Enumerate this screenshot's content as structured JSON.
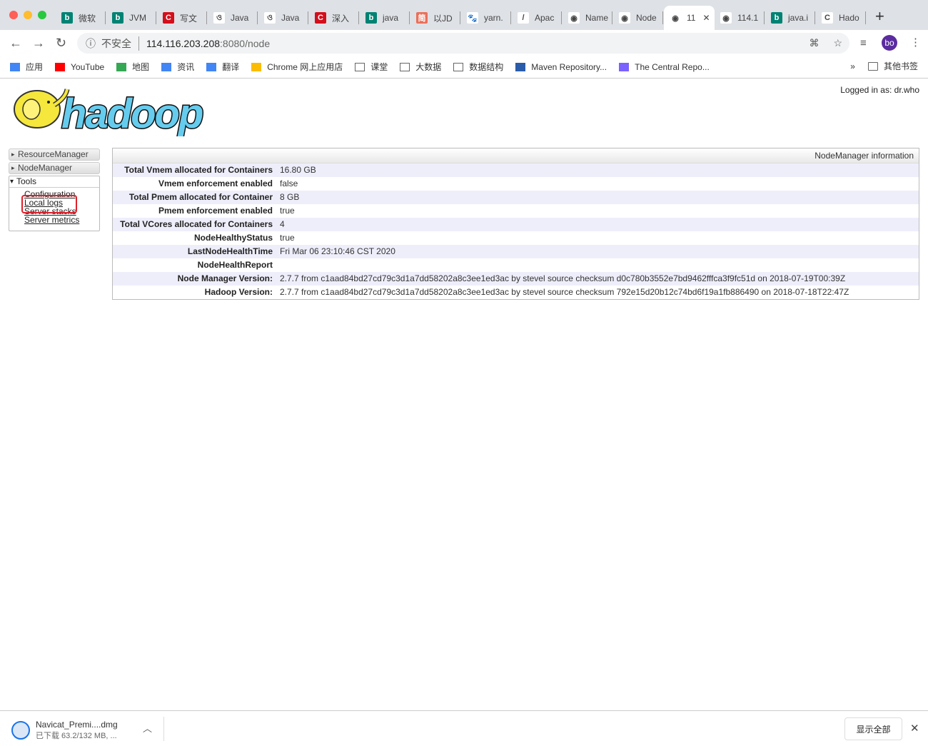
{
  "browser": {
    "tabs": [
      {
        "label": "微软",
        "icon": "bing",
        "color": "#008373"
      },
      {
        "label": "JVM",
        "icon": "bing",
        "color": "#008373"
      },
      {
        "label": "写文",
        "icon": "csdn",
        "color": "#d40e1b"
      },
      {
        "label": "Java",
        "icon": "yuque",
        "color": "#ffffff"
      },
      {
        "label": "Java",
        "icon": "yuque",
        "color": "#ffffff"
      },
      {
        "label": "深入",
        "icon": "csdn",
        "color": "#d40e1b"
      },
      {
        "label": "java",
        "icon": "bing",
        "color": "#008373"
      },
      {
        "label": "以JD",
        "icon": "jianshu",
        "color": "#ea6f5a"
      },
      {
        "label": "yarn.",
        "icon": "baidu",
        "color": "#ffffff"
      },
      {
        "label": "Apac",
        "icon": "apache",
        "color": "#ffffff"
      },
      {
        "label": "Name",
        "icon": "globe",
        "color": "#ffffff"
      },
      {
        "label": "Node",
        "icon": "globe",
        "color": "#ffffff"
      },
      {
        "label": "11",
        "icon": "globe",
        "color": "#ffffff",
        "active": true
      },
      {
        "label": "114.1",
        "icon": "globe",
        "color": "#ffffff"
      },
      {
        "label": "java.i",
        "icon": "bing",
        "color": "#008373"
      },
      {
        "label": "Hado",
        "icon": "loading",
        "color": "#ffffff"
      }
    ],
    "insecure_label": "不安全",
    "url_host": "114.116.203.208",
    "url_rest": ":8080/node",
    "profile": "bo",
    "bookmarks": [
      {
        "label": "应用",
        "icon": "apps-icon"
      },
      {
        "label": "YouTube",
        "icon": "youtube-icon"
      },
      {
        "label": "地图",
        "icon": "maps-icon"
      },
      {
        "label": "资讯",
        "icon": "news-icon"
      },
      {
        "label": "翻译",
        "icon": "translate-icon"
      },
      {
        "label": "Chrome 网上应用店",
        "icon": "webstore-icon"
      },
      {
        "label": "课堂",
        "icon": "folder-icon"
      },
      {
        "label": "大数据",
        "icon": "folder-icon"
      },
      {
        "label": "数据结构",
        "icon": "folder-icon"
      },
      {
        "label": "Maven Repository...",
        "icon": "maven-icon"
      },
      {
        "label": "The Central Repo...",
        "icon": "hexagon-icon"
      }
    ],
    "more": "»",
    "other_bookmarks": "其他书签"
  },
  "page": {
    "logged_in": "Logged in as: dr.who",
    "logo_text": "hadoop",
    "sidebar": {
      "resource_manager": "ResourceManager",
      "node_manager": "NodeManager",
      "tools": "Tools",
      "links": [
        "Configuration",
        "Local logs",
        "Server stacks",
        "Server metrics"
      ]
    },
    "info": {
      "title": "NodeManager information",
      "rows": [
        {
          "k": "Total Vmem allocated for Containers",
          "v": "16.80 GB"
        },
        {
          "k": "Vmem enforcement enabled",
          "v": "false"
        },
        {
          "k": "Total Pmem allocated for Container",
          "v": "8 GB"
        },
        {
          "k": "Pmem enforcement enabled",
          "v": "true"
        },
        {
          "k": "Total VCores allocated for Containers",
          "v": "4"
        },
        {
          "k": "NodeHealthyStatus",
          "v": "true"
        },
        {
          "k": "LastNodeHealthTime",
          "v": "Fri Mar 06 23:10:46 CST 2020"
        },
        {
          "k": "NodeHealthReport",
          "v": ""
        },
        {
          "k": "Node Manager Version:",
          "v": "2.7.7 from c1aad84bd27cd79c3d1a7dd58202a8c3ee1ed3ac by stevel source checksum d0c780b3552e7bd9462fffca3f9fc51d on 2018-07-19T00:39Z"
        },
        {
          "k": "Hadoop Version:",
          "v": "2.7.7 from c1aad84bd27cd79c3d1a7dd58202a8c3ee1ed3ac by stevel source checksum 792e15d20b12c74bd6f19a1fb886490 on 2018-07-18T22:47Z"
        }
      ]
    }
  },
  "download": {
    "filename": "Navicat_Premi....dmg",
    "status": "已下载 63.2/132 MB, ...",
    "show_all": "显示全部"
  }
}
